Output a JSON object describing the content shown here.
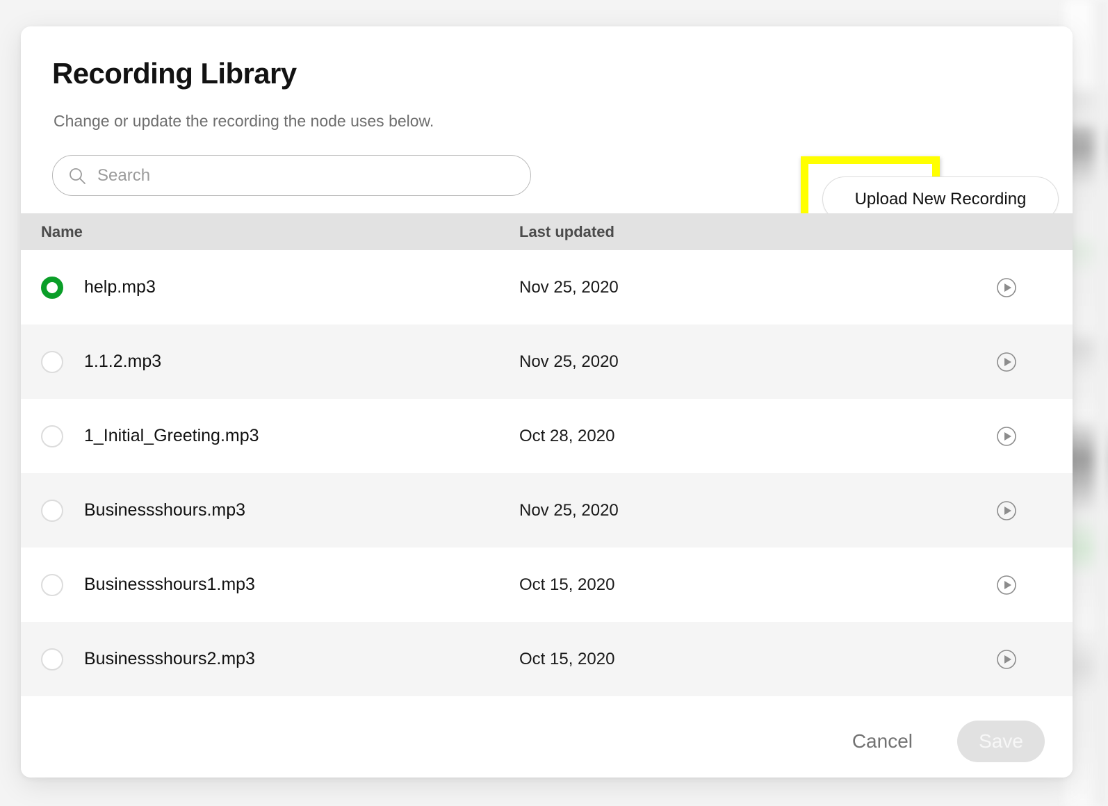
{
  "dialog": {
    "title": "Recording Library",
    "subtitle": "Change or update the recording the node uses below."
  },
  "search": {
    "placeholder": "Search",
    "value": "",
    "icon": "search-icon"
  },
  "upload": {
    "label": "Upload New Recording",
    "highlight_color": "#ffff00"
  },
  "table": {
    "columns": [
      "Name",
      "Last updated"
    ],
    "rows": [
      {
        "name": "help.mp3",
        "last_updated": "Nov 25, 2020",
        "selected": true,
        "play": "play-icon"
      },
      {
        "name": "1.1.2.mp3",
        "last_updated": "Nov 25, 2020",
        "selected": false,
        "play": "play-icon"
      },
      {
        "name": "1_Initial_Greeting.mp3",
        "last_updated": "Oct 28, 2020",
        "selected": false,
        "play": "play-icon"
      },
      {
        "name": "Businessshours.mp3",
        "last_updated": "Nov 25, 2020",
        "selected": false,
        "play": "play-icon"
      },
      {
        "name": "Businessshours1.mp3",
        "last_updated": "Oct 15, 2020",
        "selected": false,
        "play": "play-icon"
      },
      {
        "name": "Businessshours2.mp3",
        "last_updated": "Oct 15, 2020",
        "selected": false,
        "play": "play-icon"
      }
    ]
  },
  "footer": {
    "cancel_label": "Cancel",
    "save_label": "Save",
    "save_disabled": true
  },
  "colors": {
    "selected_radio": "#0a9e28",
    "header_band": "#e2e2e2",
    "row_alt": "#f5f5f5",
    "save_disabled_bg": "#e1e1e1"
  }
}
